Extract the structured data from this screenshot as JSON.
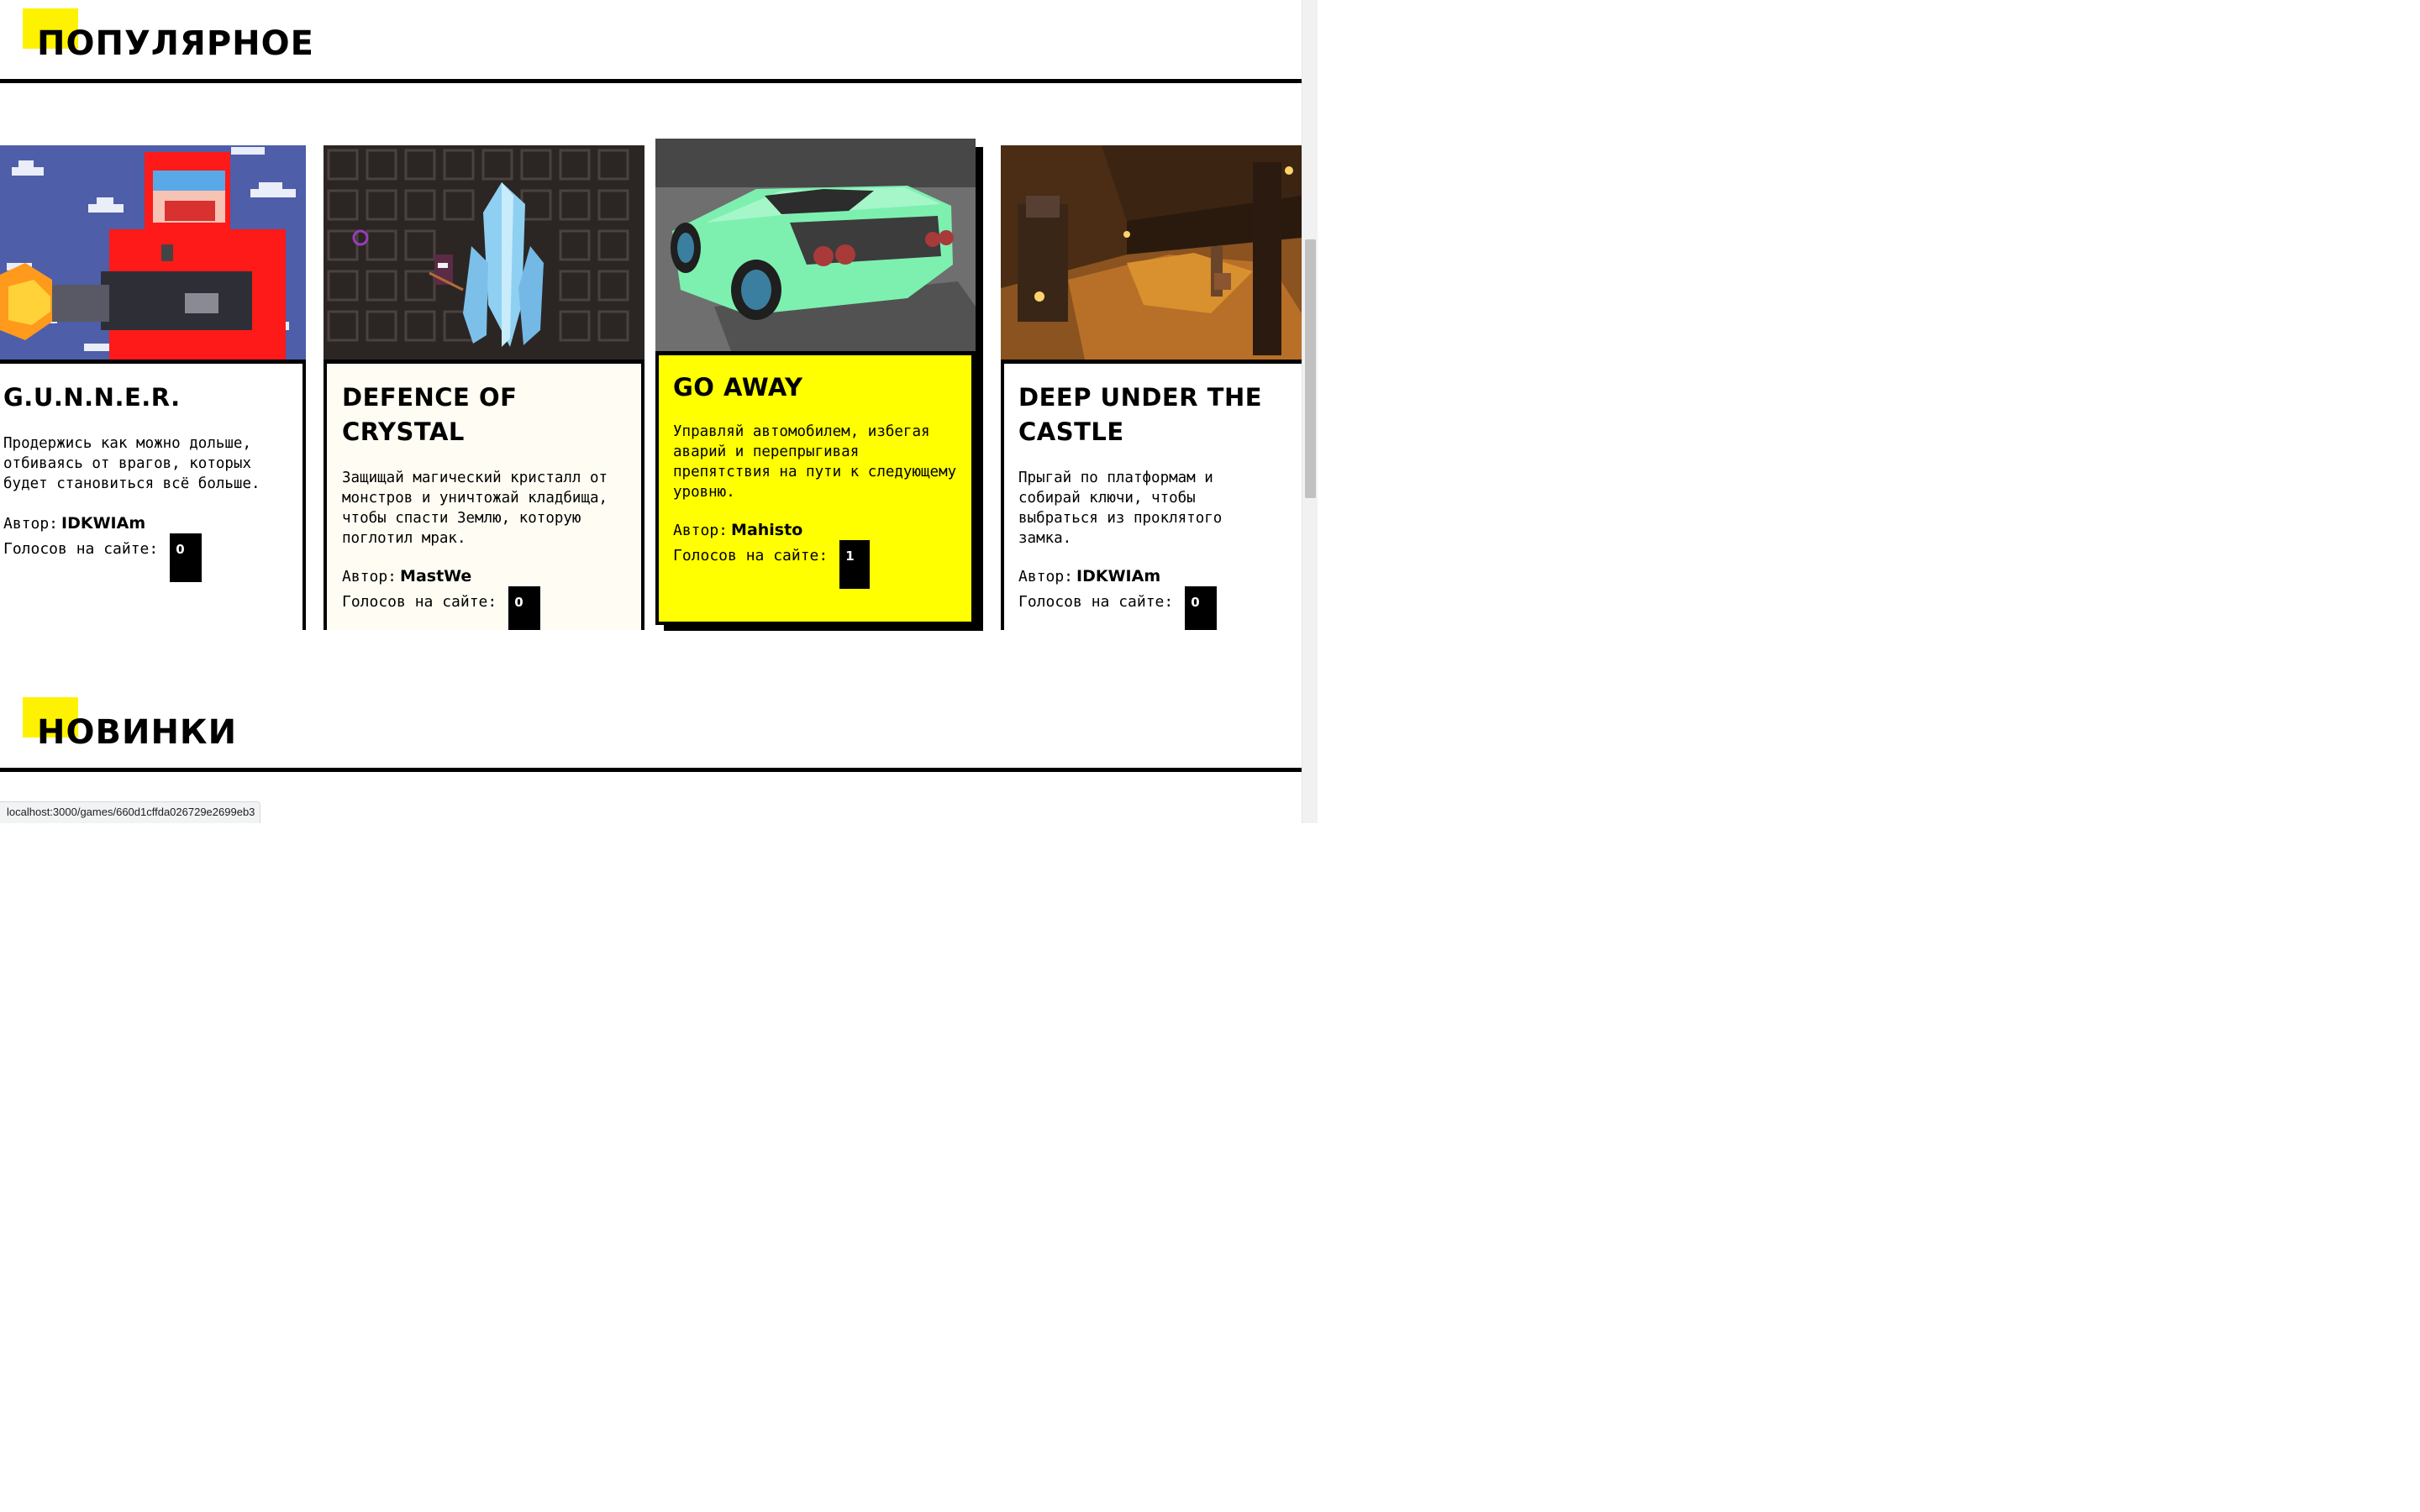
{
  "sections": {
    "popular": {
      "title": "ПОПУЛЯРНОЕ"
    },
    "new": {
      "title": "НОВИНКИ"
    }
  },
  "colors": {
    "accent": "#fff200",
    "card_bg": "#ffffff",
    "card_bg_alt": "#fffdf3",
    "card_bg_active": "#ffff00"
  },
  "labels": {
    "author": "Автор:",
    "votes": "Голосов на сайте:"
  },
  "cards": [
    {
      "title": "G.U.N.N.E.R.",
      "description": "Продержись как можно дольше, отбиваясь от врагов, которых будет становиться всё больше.",
      "author": "IDKWIAm",
      "votes": "0",
      "image": "gunner-pixel-art"
    },
    {
      "title": "DEFENCE OF CRYSTAL",
      "description": "Защищай магический кристалл от монстров и уничтожай кладбища, чтобы спасти Землю, которую поглотил мрак.",
      "author": "MastWe",
      "votes": "0",
      "image": "crystal-pixel-art"
    },
    {
      "title": "GO AWAY",
      "description": "Управляй автомобилем, избегая аварий и перепрыгивая препятствия на пути к следующему уровню.",
      "author": "Mahisto",
      "votes": "1",
      "image": "green-sports-car-render"
    },
    {
      "title": "DEEP UNDER THE CASTLE",
      "description": "Прыгай по платформам и собирай ключи, чтобы выбраться из проклятого замка.",
      "author": "IDKWIAm",
      "votes": "0",
      "image": "dungeon-room-render"
    }
  ],
  "status_bar": {
    "url": "localhost:3000/games/660d1cffda026729e2699eb3"
  }
}
